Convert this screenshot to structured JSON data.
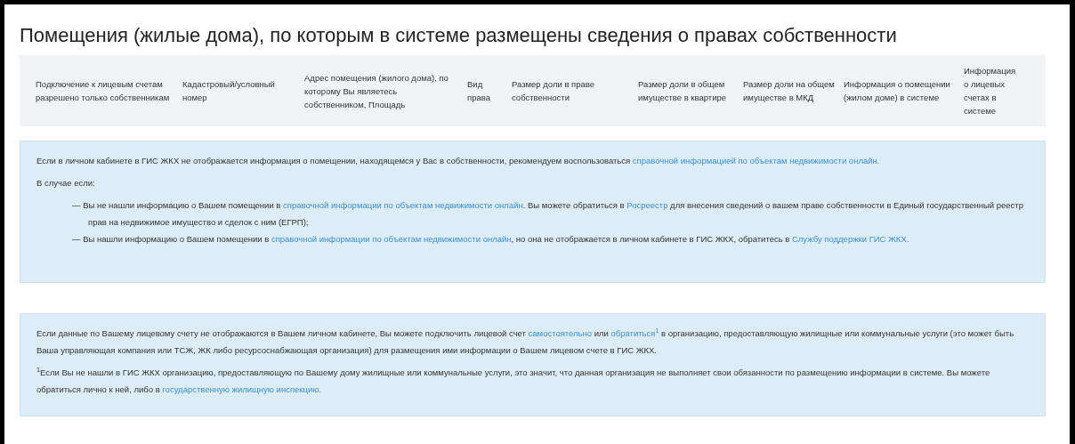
{
  "title": "Помещения (жилые дома), по которым в системе размещены сведения о правах собственности",
  "table": {
    "columns": [
      "Подключение к лицевым счетам разрешено только собственникам",
      "Кадастровый/условный номер",
      "Адрес помещения (жилого дома), по которому Вы являетесь собственником, Площадь",
      "Вид права",
      "Размер доли в праве собственности",
      "Размер доли в общем имуществе в квартире",
      "Размер доли на общем имуществе в МКД",
      "Информация о помещении (жилом доме) в системе",
      "Информация о лицевых счетах в системе"
    ]
  },
  "notices": [
    {
      "paragraphs": [
        {
          "kind": "text",
          "segments": [
            {
              "text": "Если в личном кабинете в ГИС ЖКХ не отображается информация о помещении, находящемся у Вас в собственности, рекомендуем воспользоваться ",
              "link": false
            },
            {
              "text": "справочной информацией по объектам недвижимости онлайн.",
              "link": true
            }
          ]
        },
        {
          "kind": "text",
          "segments": [
            {
              "text": "В случае если:",
              "link": false
            }
          ]
        },
        {
          "kind": "dash",
          "marker": "—",
          "segments": [
            {
              "text": "Вы не нашли информацию о Вашем помещении в ",
              "link": false
            },
            {
              "text": "справочной информации по объектам недвижимости онлайн",
              "link": true
            },
            {
              "text": ". Вы можете обратиться в ",
              "link": false
            },
            {
              "text": "Росреестр",
              "link": true
            },
            {
              "text": " для внесения сведений о вашем праве собственности в Единый государственный реестр прав на недвижимое имущество и сделок с ним (ЕГРП);",
              "link": false
            }
          ]
        },
        {
          "kind": "dash",
          "marker": "—",
          "segments": [
            {
              "text": "Вы нашли информацию о Вашем помещении в ",
              "link": false
            },
            {
              "text": "справочной информации по объектам недвижимости онлайн",
              "link": true
            },
            {
              "text": ", но она не отображается в личном кабинете в ГИС ЖКХ, обратитесь в ",
              "link": false
            },
            {
              "text": "Службу поддержки ГИС ЖКХ.",
              "link": true
            }
          ]
        }
      ]
    },
    {
      "paragraphs": [
        {
          "kind": "text",
          "segments": [
            {
              "text": "Если данные по Вашему лицевому счету не отображаются в Вашем личном кабинете, Вы можете подключить лицевой счет ",
              "link": false
            },
            {
              "text": "самостоятельно",
              "link": true
            },
            {
              "text": " или ",
              "link": false
            },
            {
              "text": "обратиться$^{1}$",
              "link": true
            },
            {
              "text": " в организацию, предоставляющую жилищные или коммунальные услуги (это может быть Ваша управляющая компания или ТСЖ, ЖК либо ресурсоснабжающая организация) для размещения ими информации о Вашем лицевом счете в ГИС ЖКХ.",
              "link": false
            }
          ]
        },
        {
          "kind": "text",
          "segments": [
            {
              "text": "$^{1}$Если Вы не нашли в ГИС ЖКХ организацию, предоставляющую по Вашему дому жилищные или коммунальные услуги, это значит, что данная организация не выполняет свои обязанности по размещению информации в системе. Вы можете обратиться лично к ней, либо в ",
              "link": false
            },
            {
              "text": "государственную жилищную инспекцию.",
              "link": true
            }
          ]
        }
      ]
    }
  ]
}
